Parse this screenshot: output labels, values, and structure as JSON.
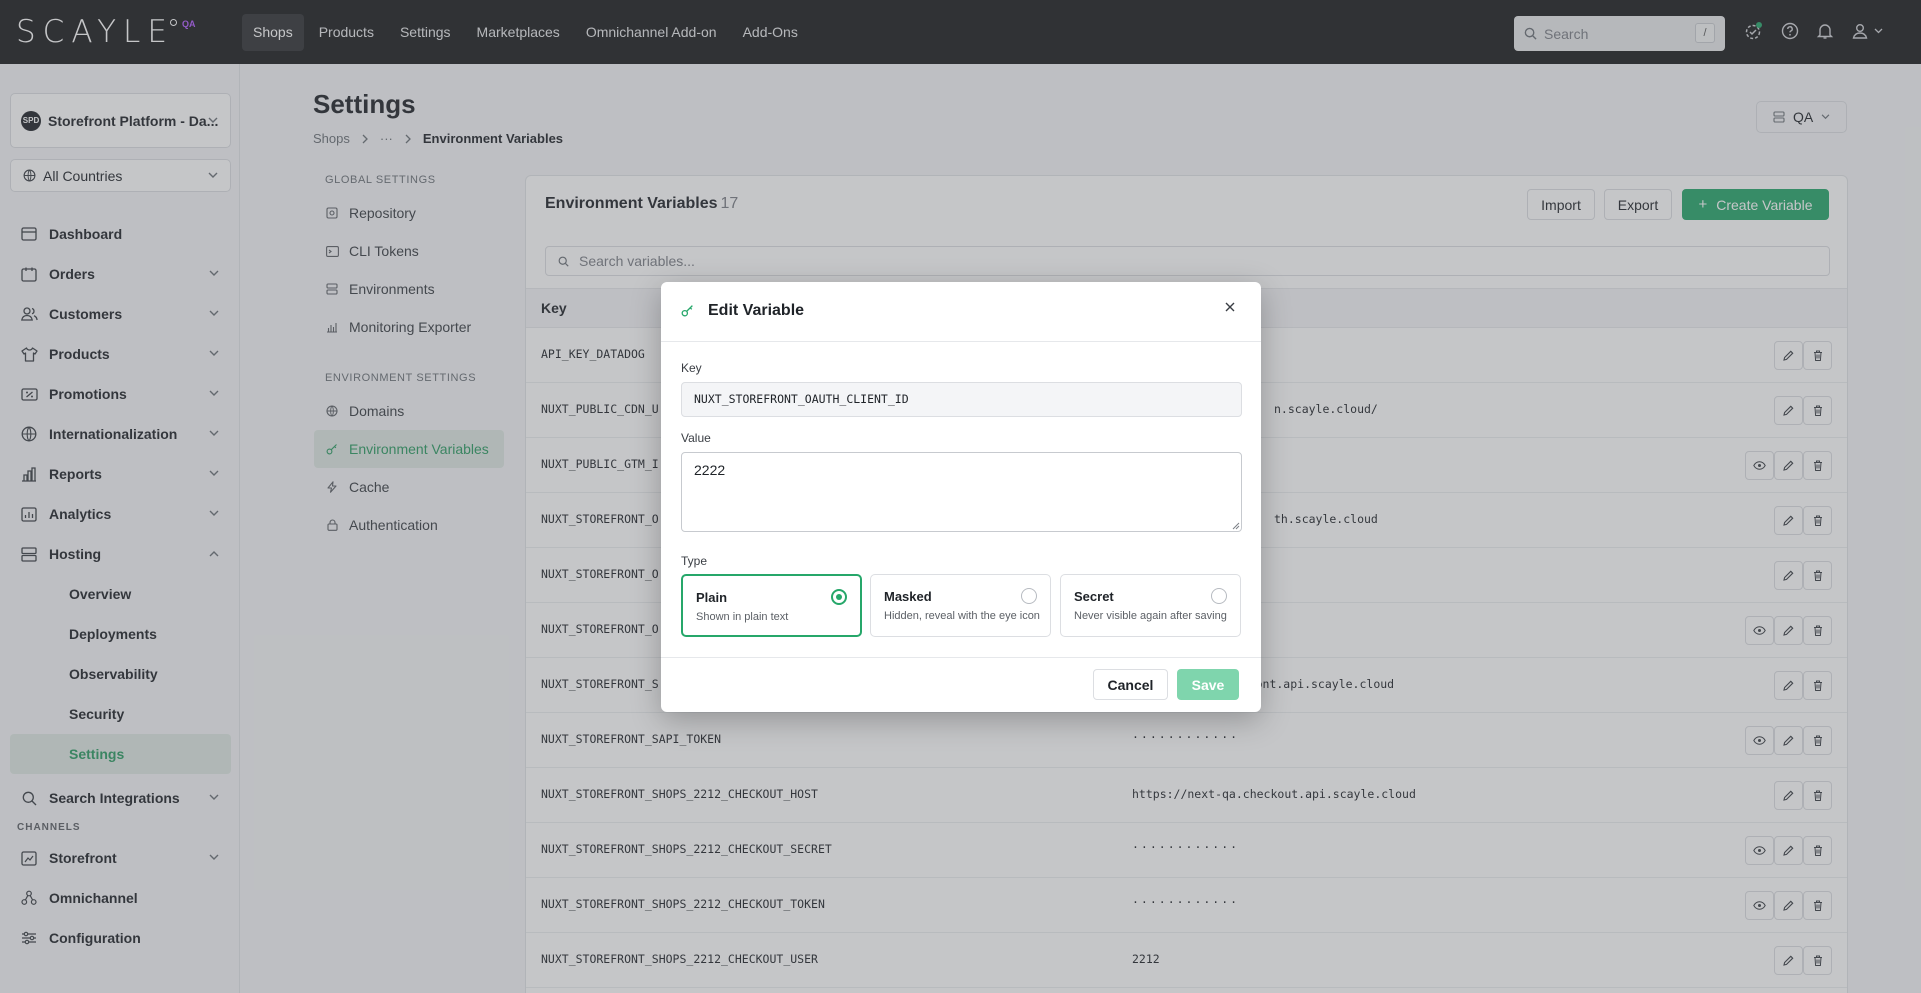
{
  "brand": {
    "logo_text": "SCAYLE",
    "env_badge": "QA"
  },
  "topnav": [
    {
      "label": "Shops"
    },
    {
      "label": "Products"
    },
    {
      "label": "Settings"
    },
    {
      "label": "Marketplaces"
    },
    {
      "label": "Omnichannel Add-on"
    },
    {
      "label": "Add-Ons"
    }
  ],
  "top_search": {
    "placeholder": "Search",
    "shortcut": "/"
  },
  "sidebar": {
    "shop": {
      "avatar": "SPD",
      "name": "Storefront Platform - Da..."
    },
    "country": "All Countries",
    "items": [
      {
        "label": "Dashboard",
        "icon": "dashboard-icon"
      },
      {
        "label": "Orders",
        "icon": "orders-icon"
      },
      {
        "label": "Customers",
        "icon": "customers-icon"
      },
      {
        "label": "Products",
        "icon": "products-icon"
      },
      {
        "label": "Promotions",
        "icon": "promotions-icon"
      },
      {
        "label": "Internationalization",
        "icon": "globe-icon"
      },
      {
        "label": "Reports",
        "icon": "reports-icon"
      },
      {
        "label": "Analytics",
        "icon": "analytics-icon"
      },
      {
        "label": "Hosting",
        "icon": "hosting-icon"
      }
    ],
    "hosting_sub": [
      {
        "label": "Overview"
      },
      {
        "label": "Deployments"
      },
      {
        "label": "Observability"
      },
      {
        "label": "Security"
      },
      {
        "label": "Settings"
      }
    ],
    "search_integrations": "Search Integrations",
    "channels_label": "CHANNELS",
    "channels": [
      {
        "label": "Storefront"
      },
      {
        "label": "Omnichannel"
      },
      {
        "label": "Configuration"
      }
    ]
  },
  "page": {
    "title": "Settings",
    "breadcrumb": {
      "root": "Shops",
      "ellipsis": "···",
      "current": "Environment Variables"
    },
    "env_selector": "QA"
  },
  "settings_nav": {
    "global_heading": "GLOBAL SETTINGS",
    "global_items": [
      {
        "label": "Repository"
      },
      {
        "label": "CLI Tokens"
      },
      {
        "label": "Environments"
      },
      {
        "label": "Monitoring Exporter"
      }
    ],
    "env_heading": "ENVIRONMENT SETTINGS",
    "env_items": [
      {
        "label": "Domains"
      },
      {
        "label": "Environment Variables"
      },
      {
        "label": "Cache"
      },
      {
        "label": "Authentication"
      }
    ]
  },
  "env_vars": {
    "title": "Environment Variables",
    "count": "17",
    "import_label": "Import",
    "export_label": "Export",
    "create_label": "Create Variable",
    "search_placeholder": "Search variables...",
    "key_header": "Key",
    "rows": [
      {
        "key": "API_KEY_DATADOG",
        "value": ""
      },
      {
        "key": "NUXT_PUBLIC_CDN_U",
        "value": "n.scayle.cloud/"
      },
      {
        "key": "NUXT_PUBLIC_GTM_I",
        "value": ""
      },
      {
        "key": "NUXT_STOREFRONT_O",
        "value": "th.scayle.cloud"
      },
      {
        "key": "NUXT_STOREFRONT_O",
        "value": ""
      },
      {
        "key": "NUXT_STOREFRONT_O",
        "value": ""
      },
      {
        "key": "NUXT_STOREFRONT_S",
        "value": "orefront.api.scayle.cloud"
      },
      {
        "key": "NUXT_STOREFRONT_SAPI_TOKEN",
        "value": "············"
      },
      {
        "key": "NUXT_STOREFRONT_SHOPS_2212_CHECKOUT_HOST",
        "value": "https://next-qa.checkout.api.scayle.cloud"
      },
      {
        "key": "NUXT_STOREFRONT_SHOPS_2212_CHECKOUT_SECRET",
        "value": "············"
      },
      {
        "key": "NUXT_STOREFRONT_SHOPS_2212_CHECKOUT_TOKEN",
        "value": "············"
      },
      {
        "key": "NUXT_STOREFRONT_SHOPS_2212_CHECKOUT_USER",
        "value": "2212"
      }
    ]
  },
  "modal": {
    "title": "Edit Variable",
    "key_label": "Key",
    "key_value": "NUXT_STOREFRONT_OAUTH_CLIENT_ID",
    "value_label": "Value",
    "value_value": "2222",
    "type_label": "Type",
    "types": [
      {
        "title": "Plain",
        "desc": "Shown in plain text",
        "selected": true
      },
      {
        "title": "Masked",
        "desc": "Hidden, reveal with the eye icon",
        "selected": false
      },
      {
        "title": "Secret",
        "desc": "Never visible again after saving",
        "selected": false
      }
    ],
    "cancel_label": "Cancel",
    "save_label": "Save"
  },
  "colors": {
    "accent": "#26a76a",
    "nav_bg": "#1b1c1e",
    "save_disabled": "#7fd5ad"
  }
}
